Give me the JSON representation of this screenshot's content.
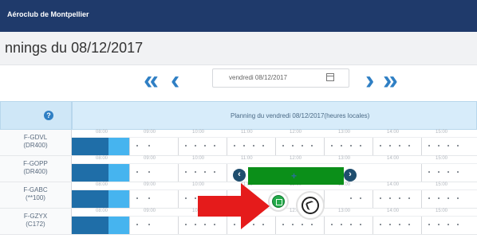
{
  "app": {
    "name": "Aéroclub de Montpellier"
  },
  "page": {
    "title": "nnings du 08/12/2017"
  },
  "navigation": {
    "prev_fast": "«",
    "prev": "‹",
    "next": "›",
    "next_fast": "»",
    "date_value": "vendredi 08/12/2017",
    "calendar_icon": "calendar-icon"
  },
  "grid": {
    "help_icon": "?",
    "header": "Planning du vendredi 08/12/2017(heures locales)",
    "hour_labels": [
      "08:00",
      "09:00",
      "10:00",
      "11:00",
      "12:00",
      "13:00",
      "14:00",
      "15:00"
    ],
    "rows": [
      {
        "line1": "F-GDVL",
        "line2": "(DR400)"
      },
      {
        "line1": "F-GOPP",
        "line2": "(DR400)"
      },
      {
        "line1": "F-GABC",
        "line2": "(**100)"
      },
      {
        "line1": "F-GZYX",
        "line2": "(C172)"
      }
    ]
  },
  "booking": {
    "move_icon": "+"
  },
  "actions": {
    "confirm_icon": "validate-icon",
    "cancel_icon": "undo-icon"
  },
  "colors": {
    "topbar": "#1f3a6b",
    "accent": "#2f7fc4",
    "booking": "#0b8f19",
    "arrow": "#e51b1b"
  }
}
